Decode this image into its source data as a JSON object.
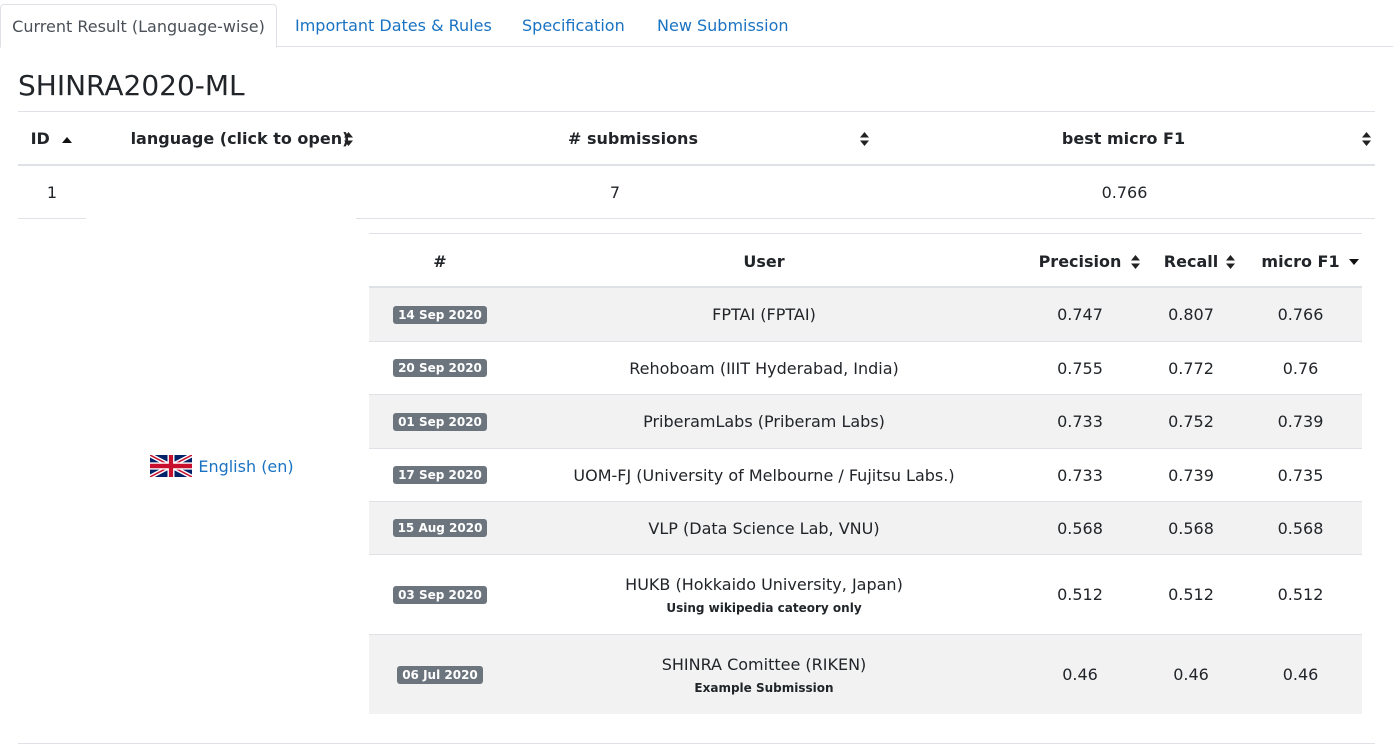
{
  "tabs": [
    {
      "label": "Current Result (Language-wise)",
      "active": true
    },
    {
      "label": "Important Dates & Rules",
      "active": false
    },
    {
      "label": "Specification",
      "active": false
    },
    {
      "label": "New Submission",
      "active": false
    }
  ],
  "page_title": "SHINRA2020-ML",
  "outer_table": {
    "headers": {
      "id": "ID",
      "language": "language (click to open)",
      "submissions": "# submissions",
      "best_f1": "best micro F1"
    },
    "sort_state": {
      "id": "ascending",
      "language": "unsorted",
      "submissions": "unsorted",
      "best_f1": "unsorted"
    },
    "row": {
      "id": "1",
      "language": "English (en)",
      "flag_icon": "uk-flag-icon",
      "submissions": "7",
      "best_f1": "0.766"
    }
  },
  "inner_table": {
    "headers": {
      "num": "#",
      "user": "User",
      "precision": "Precision",
      "recall": "Recall",
      "f1": "micro F1"
    },
    "sort_state": {
      "precision": "unsorted",
      "recall": "unsorted",
      "f1": "descending"
    },
    "rows": [
      {
        "date": "14 Sep 2020",
        "user": "FPTAI (FPTAI)",
        "note": "",
        "precision": "0.747",
        "recall": "0.807",
        "f1": "0.766"
      },
      {
        "date": "20 Sep 2020",
        "user": "Rehoboam (IIIT Hyderabad, India)",
        "note": "",
        "precision": "0.755",
        "recall": "0.772",
        "f1": "0.76"
      },
      {
        "date": "01 Sep 2020",
        "user": "PriberamLabs (Priberam Labs)",
        "note": "",
        "precision": "0.733",
        "recall": "0.752",
        "f1": "0.739"
      },
      {
        "date": "17 Sep 2020",
        "user": "UOM-FJ (University of Melbourne / Fujitsu Labs.)",
        "note": "",
        "precision": "0.733",
        "recall": "0.739",
        "f1": "0.735"
      },
      {
        "date": "15 Aug 2020",
        "user": "VLP (Data Science Lab, VNU)",
        "note": "",
        "precision": "0.568",
        "recall": "0.568",
        "f1": "0.568"
      },
      {
        "date": "03 Sep 2020",
        "user": "HUKB (Hokkaido University, Japan)",
        "note": "Using wikipedia cateory only",
        "precision": "0.512",
        "recall": "0.512",
        "f1": "0.512"
      },
      {
        "date": "06 Jul 2020",
        "user": "SHINRA Comittee (RIKEN)",
        "note": "Example Submission",
        "precision": "0.46",
        "recall": "0.46",
        "f1": "0.46"
      }
    ]
  },
  "colors": {
    "link": "#1a73c2",
    "badge": "#6c757d",
    "stripe": "#f2f2f2",
    "border": "#dee2e6"
  }
}
